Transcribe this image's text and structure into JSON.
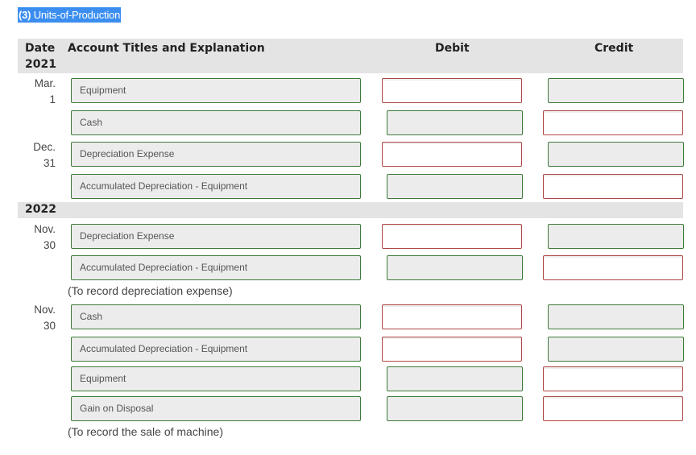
{
  "title": {
    "prefix": "(3)",
    "text": "Units-of-Production"
  },
  "header": {
    "date": "Date",
    "account": "Account Titles and Explanation",
    "debit": "Debit",
    "credit": "Credit"
  },
  "years": [
    "2021",
    "2022"
  ],
  "entries": [
    {
      "month": "Mar.",
      "day": "1"
    },
    {
      "month": "Dec.",
      "day": "31"
    },
    {
      "month": "Nov.",
      "day": "30"
    },
    {
      "month": "Nov.",
      "day": "30"
    }
  ],
  "rows": [
    {
      "account": "Equipment",
      "debit": "",
      "credit": ""
    },
    {
      "account": "Cash",
      "debit": "",
      "credit": ""
    },
    {
      "account": "Depreciation Expense",
      "debit": "",
      "credit": ""
    },
    {
      "account": "Accumulated Depreciation - Equipment",
      "debit": "",
      "credit": ""
    },
    {
      "account": "Depreciation Expense",
      "debit": "",
      "credit": ""
    },
    {
      "account": "Accumulated Depreciation - Equipment",
      "debit": "",
      "credit": ""
    },
    {
      "account": "Cash",
      "debit": "",
      "credit": ""
    },
    {
      "account": "Accumulated Depreciation - Equipment",
      "debit": "",
      "credit": ""
    },
    {
      "account": "Equipment",
      "debit": "",
      "credit": ""
    },
    {
      "account": "Gain on Disposal",
      "debit": "",
      "credit": ""
    }
  ],
  "captions": [
    "(To record depreciation expense)",
    "(To record the sale of machine)"
  ],
  "colors": {
    "highlight": "#3b8ef0",
    "correct_border": "#3e7a3a",
    "incorrect_border": "#b04545",
    "header_bg": "#e4e4e4"
  }
}
